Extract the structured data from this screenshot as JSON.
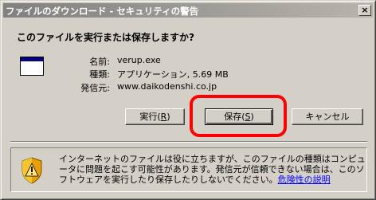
{
  "window": {
    "title": "ファイルのダウンロード - セキュリティの警告",
    "close_glyph": "×"
  },
  "dialog": {
    "question": "このファイルを実行または保存しますか?",
    "file_icon": "application-window-icon",
    "fields": [
      {
        "label": "名前:",
        "value": "verup.exe"
      },
      {
        "label": "種類:",
        "value": "アプリケーション, 5.69 MB"
      },
      {
        "label": "発信元:",
        "value": "www.daikodenshi.co.jp"
      }
    ]
  },
  "buttons": {
    "run_label": "実行(",
    "run_key": "R",
    "save_label": "保存(",
    "save_key": "S",
    "cancel_label": "キャンセル",
    "close_paren": ")"
  },
  "warning": {
    "icon": "shield-warning-icon",
    "text": "インターネットのファイルは役に立ちますが、このファイルの種類はコンピュータに問題を起こす可能性があります。発信元が信頼できない場合は、このソフトウェアを実行したり保存したりしないでください。",
    "link": "危険性の説明"
  },
  "annotation": {
    "color": "#ff0000"
  }
}
